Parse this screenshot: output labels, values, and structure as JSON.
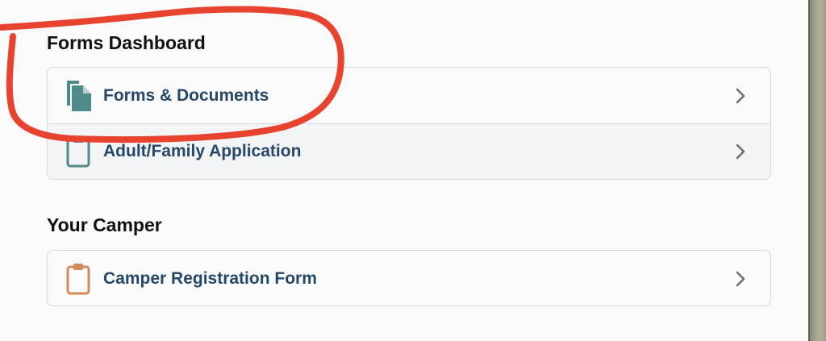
{
  "forms_dashboard": {
    "title": "Forms Dashboard",
    "items": [
      {
        "label": "Forms & Documents",
        "icon": "documents-icon"
      },
      {
        "label": "Adult/Family Application",
        "icon": "clipboard-icon"
      }
    ]
  },
  "your_camper": {
    "title": "Your Camper",
    "items": [
      {
        "label": "Camper Registration Form",
        "icon": "clipboard-icon"
      }
    ]
  },
  "annotation": {
    "color": "#e8432e",
    "shape": "hand-drawn-circle"
  },
  "colors": {
    "label": "#254768",
    "doc_icon": "#4f8a8b",
    "camper_icon": "#d38a5a",
    "chevron": "#6d6f73"
  }
}
